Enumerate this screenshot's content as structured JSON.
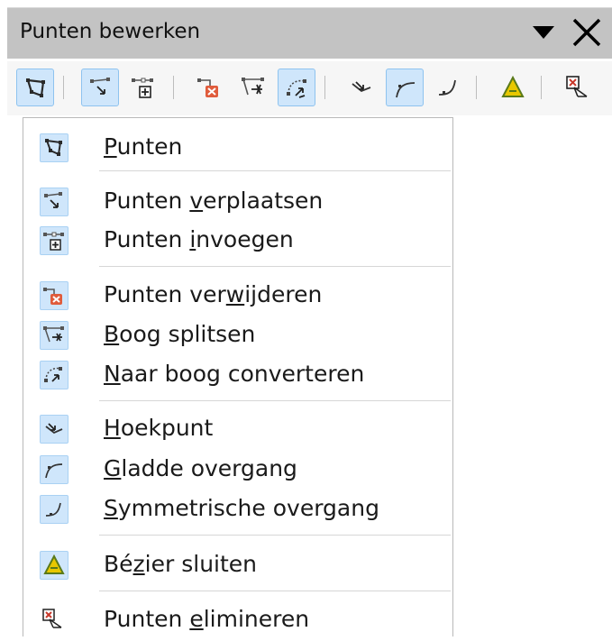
{
  "toolbar": {
    "title": "Punten bewerken",
    "dropdown_icon": "triangle-down-icon",
    "close_icon": "close-icon"
  },
  "toolbar_buttons": [
    {
      "icon": "points-icon",
      "active": true
    },
    {
      "icon": "move-points-icon",
      "active": true
    },
    {
      "icon": "insert-points-icon",
      "active": false
    },
    {
      "icon": "delete-points-icon",
      "active": false
    },
    {
      "icon": "split-curve-icon",
      "active": false
    },
    {
      "icon": "convert-to-curve-icon",
      "active": true
    },
    {
      "icon": "corner-point-icon",
      "active": false
    },
    {
      "icon": "smooth-transition-icon",
      "active": true
    },
    {
      "icon": "symmetric-transition-icon",
      "active": false
    },
    {
      "icon": "close-bezier-icon",
      "active": false
    },
    {
      "icon": "eliminate-points-icon",
      "active": false
    }
  ],
  "menu": {
    "items": [
      {
        "label_pre": "",
        "label_u": "P",
        "label_post": "unten",
        "icon": "points-icon"
      },
      {
        "label_pre": "Punten ",
        "label_u": "v",
        "label_post": "erplaatsen",
        "icon": "move-points-icon"
      },
      {
        "label_pre": "Punten ",
        "label_u": "i",
        "label_post": "nvoegen",
        "icon": "insert-points-icon"
      },
      {
        "label_pre": "Punten ver",
        "label_u": "w",
        "label_post": "ijderen",
        "icon": "delete-points-icon"
      },
      {
        "label_pre": "",
        "label_u": "B",
        "label_post": "oog splitsen",
        "icon": "split-curve-icon"
      },
      {
        "label_pre": "",
        "label_u": "N",
        "label_post": "aar boog converteren",
        "icon": "convert-to-curve-icon"
      },
      {
        "label_pre": "",
        "label_u": "H",
        "label_post": "oekpunt",
        "icon": "corner-point-icon"
      },
      {
        "label_pre": "",
        "label_u": "G",
        "label_post": "ladde overgang",
        "icon": "smooth-transition-icon"
      },
      {
        "label_pre": "",
        "label_u": "S",
        "label_post": "ymmetrische overgang",
        "icon": "symmetric-transition-icon"
      },
      {
        "label_pre": "Bé",
        "label_u": "z",
        "label_post": "ier sluiten",
        "icon": "close-bezier-icon"
      },
      {
        "label_pre": "Punten ",
        "label_u": "e",
        "label_post": "limineren",
        "icon": "eliminate-points-icon"
      }
    ]
  },
  "colors": {
    "titlebar_bg": "#c3c3c3",
    "toolbar_bg": "#f6f6f6",
    "active_bg": "#cfe6fb",
    "active_border": "#8ec3ef"
  }
}
